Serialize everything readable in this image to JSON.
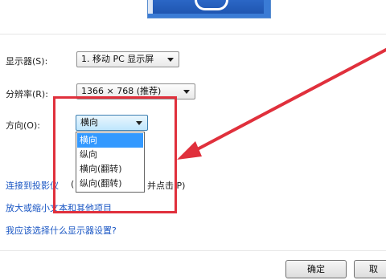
{
  "display": {
    "label": "显示器(S):",
    "value": "1. 移动 PC 显示屏"
  },
  "resolution": {
    "label": "分辨率(R):",
    "value": "1366 × 768 (推荐)"
  },
  "orientation": {
    "label": "方向(O):",
    "value": "横向",
    "options": [
      "横向",
      "纵向",
      "横向(翻转)",
      "纵向(翻转)"
    ]
  },
  "links": {
    "projector_prefix": "连接到投影仪",
    "projector_suffix_partial": "(",
    "projector_end": "并点击 P)",
    "magnify": "放大或缩小文本和其他项目",
    "which_settings": "我应该选择什么显示器设置?"
  },
  "buttons": {
    "ok": "确定",
    "cancel_partial": "取"
  },
  "colors": {
    "annotation_red": "#e0303c",
    "selection_blue": "#3399ff",
    "link_blue": "#1b57c4"
  }
}
